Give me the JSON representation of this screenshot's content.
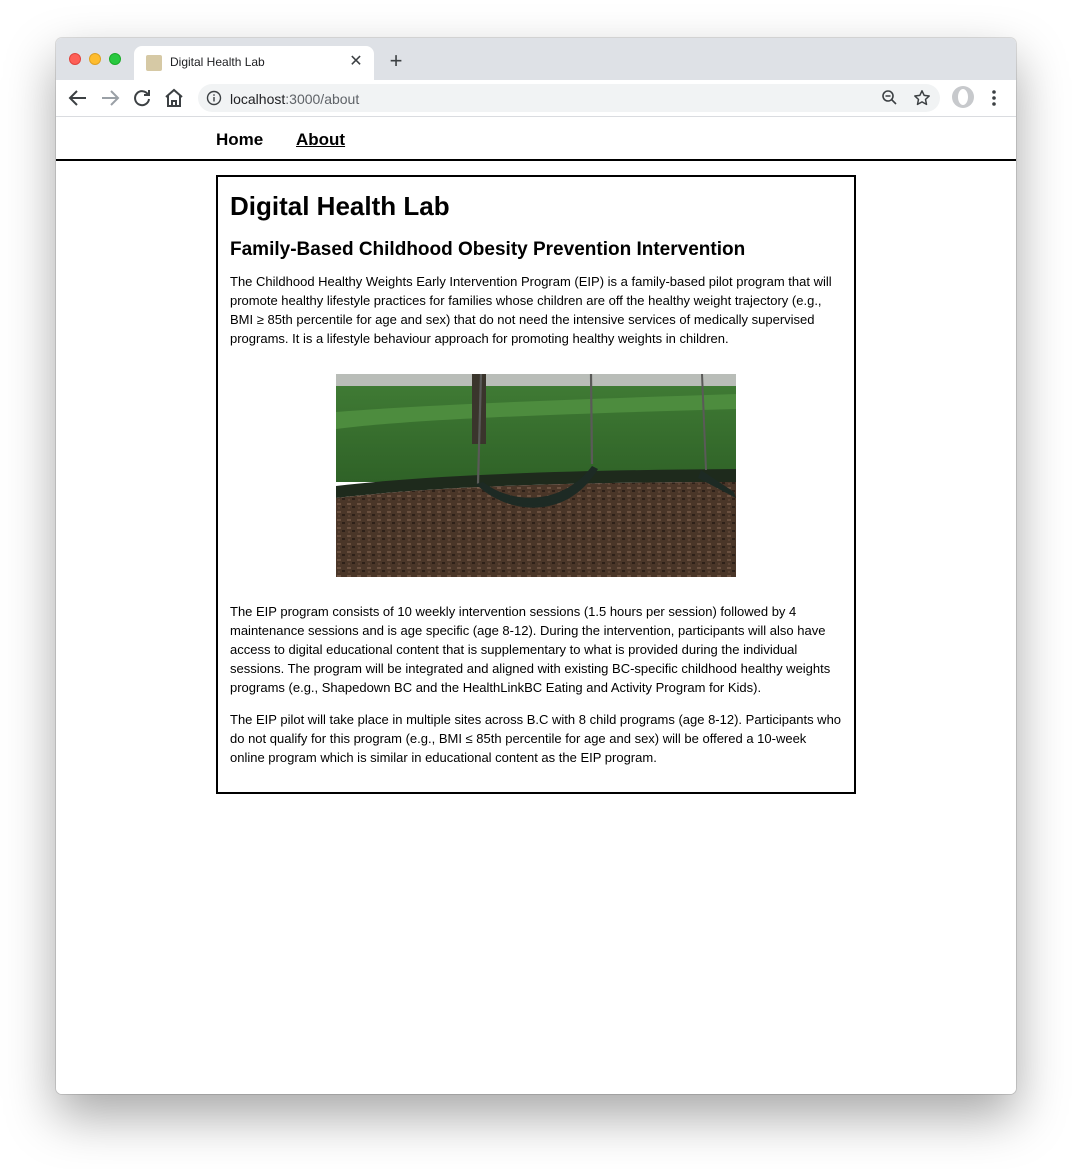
{
  "browser": {
    "tab_title": "Digital Health Lab",
    "tab_close": "✕",
    "new_tab": "+",
    "url_host": "localhost",
    "url_path": ":3000/about"
  },
  "nav": {
    "home": "Home",
    "about": "About"
  },
  "page": {
    "title": "Digital Health Lab",
    "section_title": "Family-Based Childhood Obesity Prevention Intervention",
    "paragraph_1": "The Childhood Healthy Weights Early Intervention Program (EIP) is a family-based pilot program that will promote healthy lifestyle practices for families whose children are off the healthy weight trajectory (e.g., BMI ≥ 85th percentile for age and sex) that do not need the intensive services of medically supervised programs. It is a lifestyle behaviour approach for promoting healthy weights in children.",
    "paragraph_2": "The EIP program consists of 10 weekly intervention sessions (1.5 hours per session) followed by 4 maintenance sessions and is age specific (age 8-12). During the intervention, participants will also have access to digital educational content that is supplementary to what is provided during the individual sessions. The program will be integrated and aligned with existing BC-specific childhood healthy weights programs (e.g., Shapedown BC and the HealthLinkBC Eating and Activity Program for Kids).",
    "paragraph_3": "The EIP pilot will take place in multiple sites across B.C with 8 child programs (age 8-12). Participants who do not qualify for this program (e.g., BMI ≤ 85th percentile for age and sex) will be offered a 10-week online program which is similar in educational content as the EIP program."
  },
  "icons": {
    "back": "back-arrow-icon",
    "forward": "forward-arrow-icon",
    "reload": "reload-icon",
    "home": "home-icon",
    "info": "info-icon",
    "zoom": "zoom-out-icon",
    "star": "bookmark-star-icon",
    "menu": "kebab-menu-icon"
  },
  "colors": {
    "titlebar": "#dee1e6",
    "omnibox": "#f1f3f4",
    "favicon": "#d6c9a5"
  }
}
